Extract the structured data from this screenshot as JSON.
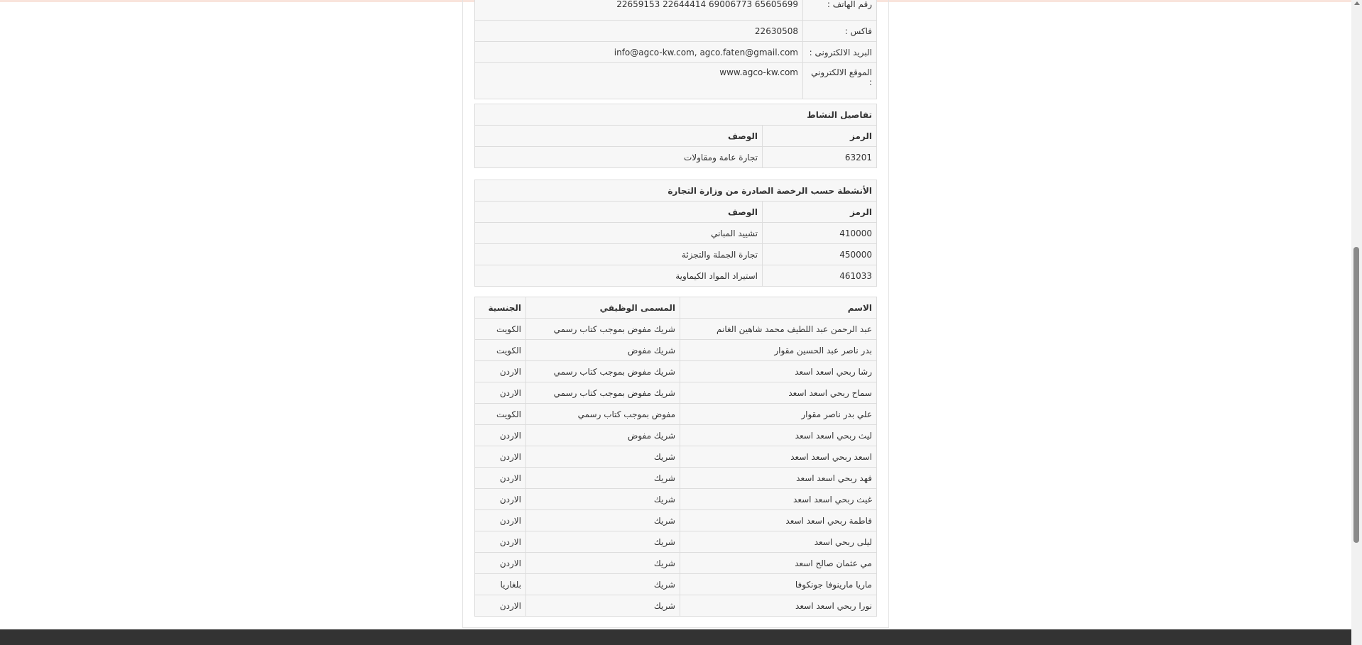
{
  "contact": [
    {
      "label": "رقم الهاتف :",
      "value": "65605699 69006773 22644414 22659153"
    },
    {
      "label": "فاكس :",
      "value": "22630508"
    },
    {
      "label": "البريد الالكترونى :",
      "value": "info@agco-kw.com, agco.faten@gmail.com"
    },
    {
      "label": "الموقع الالكتروني :",
      "value": "www.agco-kw.com"
    }
  ],
  "activity": {
    "title": "تفاصيل النشاط",
    "code_header": "الرمز",
    "desc_header": "الوصف",
    "rows": [
      {
        "code": "63201",
        "desc": "تجارة عامة ومقاولات"
      }
    ]
  },
  "licensed": {
    "title": "الأنشطة حسب الرخصة الصادرة من وزارة التجارة",
    "code_header": "الرمز",
    "desc_header": "الوصف",
    "rows": [
      {
        "code": "410000",
        "desc": "تشييد المباني"
      },
      {
        "code": "450000",
        "desc": "تجارة الجملة والتجزئة"
      },
      {
        "code": "461033",
        "desc": "استيراد المواد الكيماوية"
      }
    ]
  },
  "people": {
    "headers": {
      "name": "الاسم",
      "title": "المسمى الوظيفي",
      "nationality": "الجنسية"
    },
    "rows": [
      {
        "name": "عبد الرحمن عبد اللطيف محمد شاهين الغانم",
        "title": "شريك مفوض بموجب كتاب رسمي",
        "nationality": "الكويت"
      },
      {
        "name": "بدر ناصر عبد الحسين مقوار",
        "title": "شريك مفوض",
        "nationality": "الكويت"
      },
      {
        "name": "رشا ربحي اسعد اسعد",
        "title": "شريك مفوض بموجب كتاب رسمي",
        "nationality": "الاردن"
      },
      {
        "name": "سماح ربحي اسعد اسعد",
        "title": "شريك مفوض بموجب كتاب رسمي",
        "nationality": "الاردن"
      },
      {
        "name": "علي بدر ناصر مقوار",
        "title": "مفوض بموجب كتاب رسمي",
        "nationality": "الكويت"
      },
      {
        "name": "ليث ربحي اسعد اسعد",
        "title": "شريك مفوض",
        "nationality": "الاردن"
      },
      {
        "name": "اسعد ربحي اسعد اسعد",
        "title": "شريك",
        "nationality": "الاردن"
      },
      {
        "name": "فهد ربحي اسعد اسعد",
        "title": "شريك",
        "nationality": "الاردن"
      },
      {
        "name": "غيث ربحي اسعد اسعد",
        "title": "شريك",
        "nationality": "الاردن"
      },
      {
        "name": "فاطمة ربحي اسعد اسعد",
        "title": "شريك",
        "nationality": "الاردن"
      },
      {
        "name": "ليلى ربحي اسعد",
        "title": "شريك",
        "nationality": "الاردن"
      },
      {
        "name": "مي عثمان صالح اسعد",
        "title": "شريك",
        "nationality": "الاردن"
      },
      {
        "name": "ماريا مارينوفا جونكوفا",
        "title": "شريك",
        "nationality": "بلغاريا"
      },
      {
        "name": "نورا ربحي اسعد اسعد",
        "title": "شريك",
        "nationality": "الاردن"
      }
    ]
  }
}
